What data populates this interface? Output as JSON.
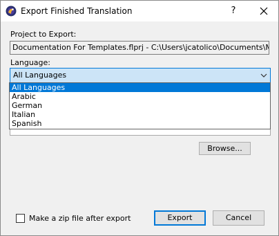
{
  "window": {
    "title": "Export Finished Translation"
  },
  "titlebar": {
    "help_label": "?"
  },
  "form": {
    "project_label": "Project to Export:",
    "project_path": "Documentation For Templates.flprj - C:\\Users\\jcatolico\\Documents\\My Transla",
    "language_label": "Language:",
    "language_selected": "All Languages",
    "language_options": [
      "All Languages",
      "Arabic",
      "German",
      "Italian",
      "Spanish"
    ],
    "browse_label": "Browse..."
  },
  "footer": {
    "zip_label": "Make a zip file after export",
    "zip_checked": false,
    "export_label": "Export",
    "cancel_label": "Cancel"
  },
  "colors": {
    "accent": "#0078d7",
    "combo_bg": "#cce4f7",
    "dialog_bg": "#f0f0f0"
  }
}
